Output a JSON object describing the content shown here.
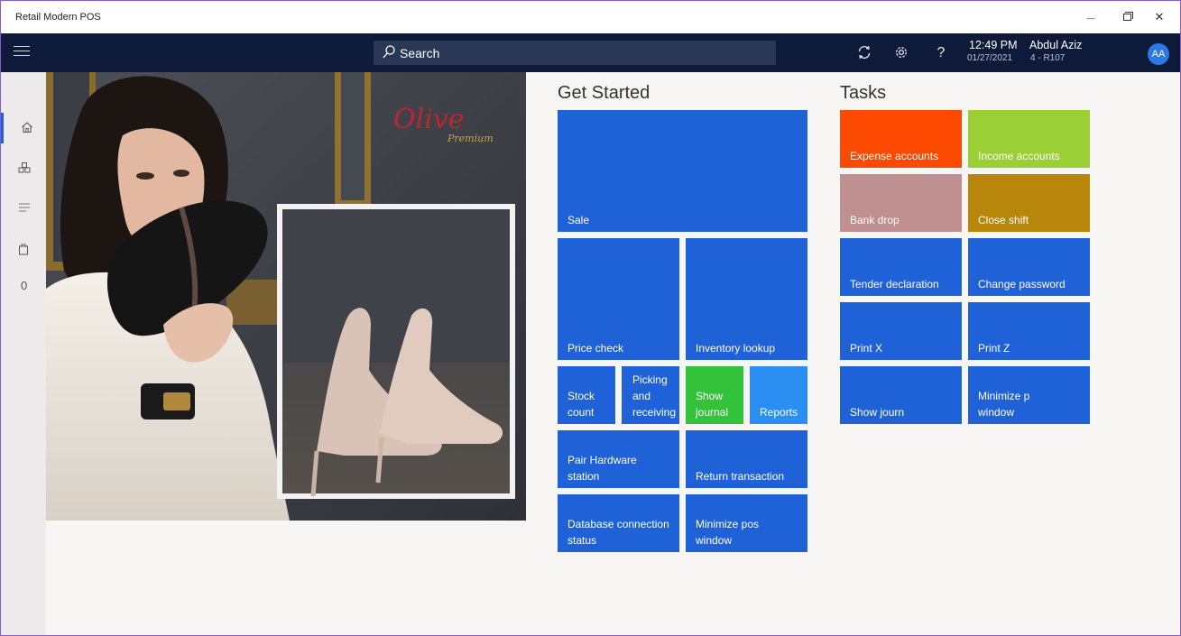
{
  "window": {
    "title": "Retail Modern POS",
    "controls": {
      "minimize": "—",
      "close": "✕"
    }
  },
  "header": {
    "search_label": "Search",
    "time": "12:49 PM",
    "date": "01/27/2021",
    "user_name": "Abdul Aziz",
    "register": "4 - R107",
    "avatar_initials": "AA",
    "help": "?"
  },
  "sidebar": {
    "items": [
      {
        "icon": "home-icon"
      },
      {
        "icon": "products-icon"
      },
      {
        "icon": "list-icon"
      },
      {
        "icon": "cart-icon"
      }
    ],
    "cart_count": "0"
  },
  "hero": {
    "brand_text": "Olive",
    "brand_sub": "Premium"
  },
  "get_started": {
    "title": "Get Started",
    "tiles": [
      {
        "label": "Sale",
        "color": "#1f62d8"
      },
      {
        "label": "Price check",
        "color": "#1f62d8"
      },
      {
        "label": "Inventory lookup",
        "color": "#1f62d8"
      },
      {
        "label": "Stock\ncount",
        "color": "#1f62d8"
      },
      {
        "label": "Picking\nand\nreceiving",
        "color": "#1f62d8"
      },
      {
        "label": "Show\njournal",
        "color": "#33c33a"
      },
      {
        "label": "Reports",
        "color": "#2a8ef2"
      },
      {
        "label": "Pair Hardware\nstation",
        "color": "#1f62d8"
      },
      {
        "label": "Return transaction",
        "color": "#1f62d8"
      },
      {
        "label": "Database connection\nstatus",
        "color": "#1f62d8"
      },
      {
        "label": "Minimize pos\nwindow",
        "color": "#1f62d8"
      }
    ]
  },
  "tasks": {
    "title": "Tasks",
    "tiles": [
      {
        "label": "Expense accounts",
        "color": "#fc4a00"
      },
      {
        "label": "Income accounts",
        "color": "#9bcf36"
      },
      {
        "label": "Bank drop",
        "color": "#c09090"
      },
      {
        "label": "Close shift",
        "color": "#b8860b"
      },
      {
        "label": "Tender declaration",
        "color": "#1f62d8"
      },
      {
        "label": "Change password",
        "color": "#1f62d8"
      },
      {
        "label": "Print X",
        "color": "#1f62d8"
      },
      {
        "label": "Print Z",
        "color": "#1f62d8"
      },
      {
        "label": "Show journ",
        "color": "#1f62d8"
      },
      {
        "label": "Minimize p\nwindow",
        "color": "#1f62d8"
      }
    ]
  }
}
